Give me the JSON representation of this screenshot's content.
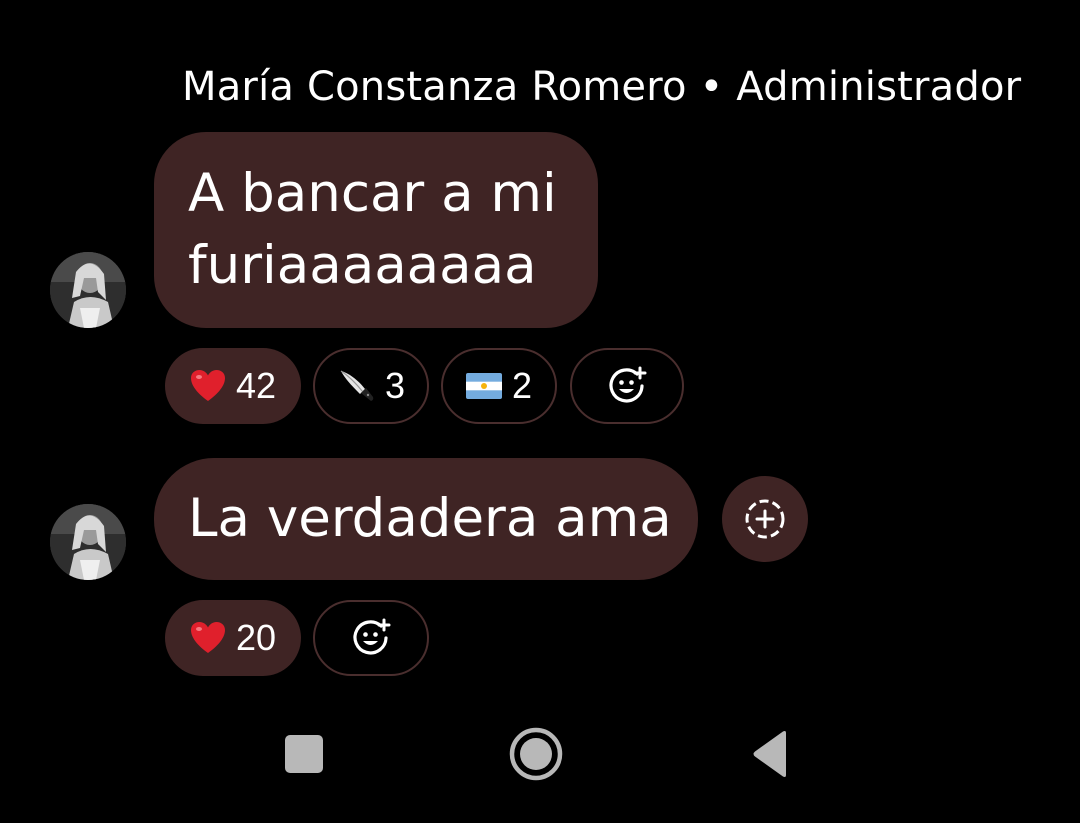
{
  "sender": {
    "name": "María Constanza Romero",
    "separator": "•",
    "role": "Administrador"
  },
  "messages": [
    {
      "text": "A bancar a mi furiaaaaaaaa",
      "reactions": [
        {
          "emoji": "red-heart",
          "count": "42"
        },
        {
          "emoji": "kitchen-knife",
          "count": "3"
        },
        {
          "emoji": "argentina-flag",
          "count": "2"
        }
      ]
    },
    {
      "text": "La verdadera ama",
      "reactions": [
        {
          "emoji": "red-heart",
          "count": "20"
        }
      ]
    }
  ],
  "colors": {
    "background": "#000000",
    "bubble": "#3f2424",
    "chip_outline": "#4a2e2e",
    "text": "#ffffff",
    "navbar_icon": "#b8b8b8"
  },
  "icons": {
    "add_reaction": "smiley-plus-icon",
    "quick_action": "dashed-circle-plus-icon",
    "nav_recents": "square-icon",
    "nav_home": "circle-icon",
    "nav_back": "triangle-back-icon"
  }
}
